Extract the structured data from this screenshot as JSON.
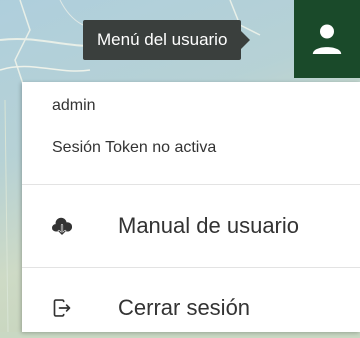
{
  "tooltip": {
    "text": "Menú del usuario"
  },
  "user_button": {
    "icon": "user-icon",
    "bg_color": "#1a4a2a"
  },
  "menu": {
    "username": "admin",
    "session_status": "Sesión Token no activa",
    "items": [
      {
        "label": "Manual de usuario",
        "icon": "cloud-download-icon"
      },
      {
        "label": "Cerrar sesión",
        "icon": "logout-icon"
      }
    ]
  }
}
